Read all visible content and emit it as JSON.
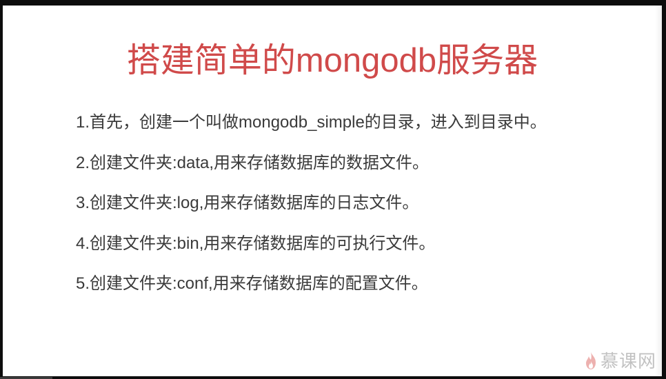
{
  "slide": {
    "title": "搭建简单的mongodb服务器",
    "bullets": [
      {
        "text": "1.首先，创建一个叫做mongodb_simple的目录，进入到目录中。"
      },
      {
        "text": "2.创建文件夹:data,用来存储数据库的数据文件。"
      },
      {
        "text": "3.创建文件夹:log,用来存储数据库的日志文件。"
      },
      {
        "text": "4.创建文件夹:bin,用来存储数据库的可执行文件。"
      },
      {
        "text": "5.创建文件夹:conf,用来存储数据库的配置文件。"
      }
    ]
  },
  "watermark": {
    "icon": "flame-logo-icon",
    "text": "慕课网"
  },
  "colors": {
    "title": "#d04a4a",
    "body_text": "#3a3a3a",
    "background": "#ffffff",
    "frame": "#0d0d0d"
  }
}
